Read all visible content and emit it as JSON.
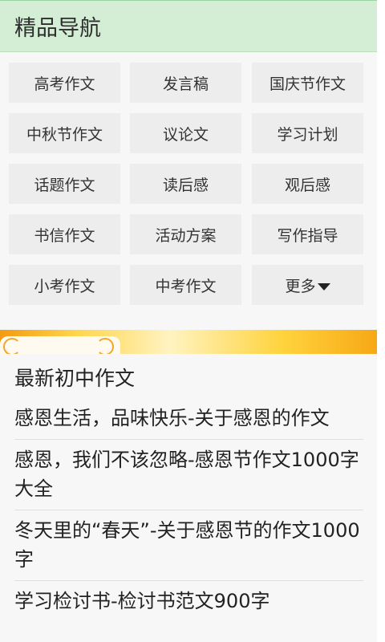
{
  "header": {
    "title": "精品导航"
  },
  "nav": {
    "cells": [
      "高考作文",
      "发言稿",
      "国庆节作文",
      "中秋节作文",
      "议论文",
      "学习计划",
      "话题作文",
      "读后感",
      "观后感",
      "书信作文",
      "活动方案",
      "写作指导",
      "小考作文",
      "中考作文",
      "更多"
    ],
    "more_icon": "caret-down-icon"
  },
  "section": {
    "title": "最新初中作文"
  },
  "articles": [
    "感恩生活，品味快乐-关于感恩的作文",
    "感恩，我们不该忽略-感恩节作文1000字大全",
    "冬天里的“春天”-关于感恩节的作文1000字",
    "学习检讨书-检讨书范文900字"
  ],
  "colors": {
    "header_bg": "#d4eed6",
    "cell_bg": "#ededed",
    "banner_accent": "#f7a816"
  }
}
